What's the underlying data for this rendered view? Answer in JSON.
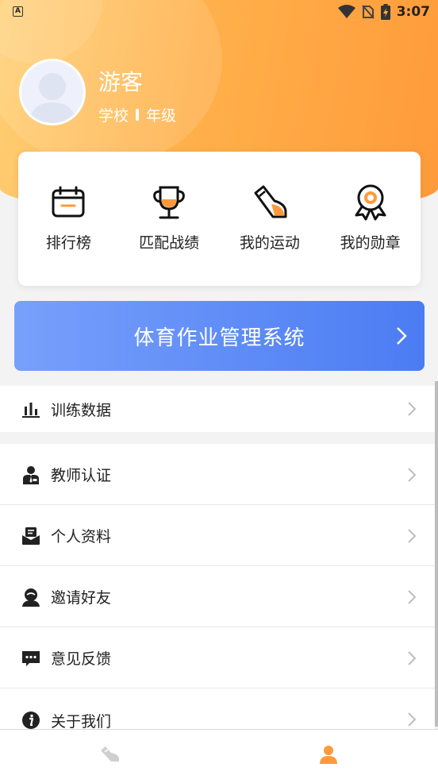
{
  "status_bar": {
    "time": "3:07",
    "indicator": "A"
  },
  "profile": {
    "name": "游客",
    "school": "学校",
    "grade": "年级"
  },
  "quick_actions": [
    {
      "label": "排行榜",
      "icon": "calendar-icon"
    },
    {
      "label": "匹配战绩",
      "icon": "trophy-icon"
    },
    {
      "label": "我的运动",
      "icon": "shoe-icon"
    },
    {
      "label": "我的勋章",
      "icon": "medal-icon"
    }
  ],
  "banner": {
    "title": "体育作业管理系统"
  },
  "menu": [
    {
      "label": "训练数据",
      "icon": "bar-chart-icon"
    },
    {
      "label": "教师认证",
      "icon": "teacher-icon"
    },
    {
      "label": "个人资料",
      "icon": "profile-card-icon"
    },
    {
      "label": "邀请好友",
      "icon": "invite-friend-icon"
    },
    {
      "label": "意见反馈",
      "icon": "feedback-icon"
    },
    {
      "label": "关于我们",
      "icon": "info-icon"
    }
  ],
  "bottom_nav": [
    {
      "name": "sport",
      "icon": "sneaker-icon",
      "active": false
    },
    {
      "name": "me",
      "icon": "user-icon",
      "active": true
    }
  ],
  "colors": {
    "accent": "#ff9a3a",
    "banner": "#5c8af6",
    "inactive": "#cfcfcf"
  }
}
